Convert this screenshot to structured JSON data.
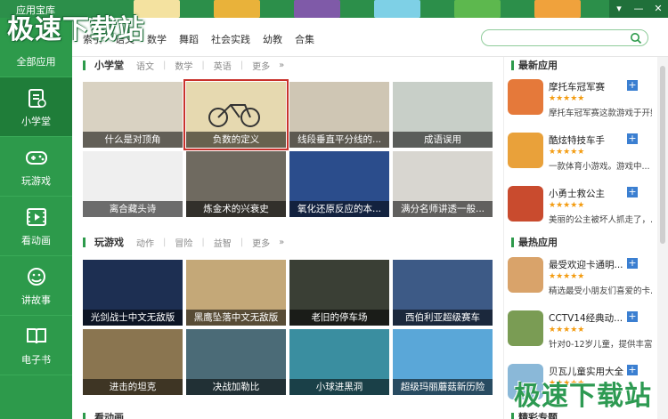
{
  "app": {
    "title": "应用宝库",
    "watermark": "极速下载站",
    "controls": [
      "▾",
      "—",
      "✕"
    ]
  },
  "colors": {
    "brand": "#2d9a4b",
    "sidebar_active": "#1f7d39",
    "highlight": "#c9322c",
    "add": "#3b7fd1",
    "stars": "#f39c12"
  },
  "sidebar": {
    "items": [
      {
        "label": "全部应用",
        "icon": "grid-icon",
        "active": false
      },
      {
        "label": "小学堂",
        "icon": "book-icon",
        "active": true
      },
      {
        "label": "玩游戏",
        "icon": "gamepad-icon",
        "active": false
      },
      {
        "label": "看动画",
        "icon": "film-icon",
        "active": false
      },
      {
        "label": "讲故事",
        "icon": "story-icon",
        "active": false
      },
      {
        "label": "电子书",
        "icon": "ebook-icon",
        "active": false
      }
    ]
  },
  "nav": {
    "links": [
      "索引",
      "语文",
      "数学",
      "舞蹈",
      "社会实践",
      "幼教",
      "合集"
    ],
    "search_placeholder": ""
  },
  "sections": [
    {
      "name": "小学堂",
      "tags": [
        "语文",
        "数学",
        "英语",
        "更多"
      ],
      "tiles": [
        {
          "caption": "什么是对顶角",
          "color": "#d9d2c2",
          "highlight": false
        },
        {
          "caption": "负数的定义",
          "color": "#e6d9b0",
          "highlight": true
        },
        {
          "caption": "线段垂直平分线的...",
          "color": "#cfc6b4",
          "highlight": false
        },
        {
          "caption": "成语误用",
          "color": "#c8cfc8",
          "highlight": false
        },
        {
          "caption": "离合藏头诗",
          "color": "#efefef",
          "highlight": false
        },
        {
          "caption": "炼金术的兴衰史",
          "color": "#6f6a60",
          "highlight": false
        },
        {
          "caption": "氧化还原反应的本...",
          "color": "#2b4d8c",
          "highlight": false
        },
        {
          "caption": "满分名师讲透一般...",
          "color": "#d8d6d0",
          "highlight": false
        }
      ]
    },
    {
      "name": "玩游戏",
      "tags": [
        "动作",
        "冒险",
        "益智",
        "更多"
      ],
      "tiles": [
        {
          "caption": "光剑战士中文无敌版",
          "color": "#1d2f52",
          "highlight": false
        },
        {
          "caption": "黑鹰坠落中文无敌版",
          "color": "#c4a878",
          "highlight": false
        },
        {
          "caption": "老旧的停车场",
          "color": "#3a3f35",
          "highlight": false
        },
        {
          "caption": "西伯利亚超级赛车",
          "color": "#3d5a86",
          "highlight": false
        },
        {
          "caption": "进击的坦克",
          "color": "#8a7550",
          "highlight": false
        },
        {
          "caption": "决战加勒比",
          "color": "#4b6b77",
          "highlight": false
        },
        {
          "caption": "小球进黑洞",
          "color": "#3a8ea0",
          "highlight": false
        },
        {
          "caption": "超级玛丽蘑菇新历险",
          "color": "#5aa7d8",
          "highlight": false
        }
      ]
    }
  ],
  "bottom_section_peek": "看动画",
  "right": {
    "newest": {
      "title": "最新应用",
      "items": [
        {
          "title": "摩托车冠军赛",
          "stars": "★★★★★",
          "desc": "摩托车冠军赛这款游戏于开始...",
          "color": "#e5793a"
        },
        {
          "title": "酷炫特技车手",
          "stars": "★★★★★",
          "desc": "一款体育小游戏。游戏中...",
          "color": "#e9a13a"
        },
        {
          "title": "小勇士救公主",
          "stars": "★★★★★",
          "desc": "美丽的公主被坏人抓走了，...",
          "color": "#c94b2e"
        }
      ]
    },
    "hottest": {
      "title": "最热应用",
      "items": [
        {
          "title": "最受欢迎卡通明...",
          "stars": "★★★★★",
          "desc": "精选最受小朋友们喜爱的卡...",
          "color": "#d9a36a"
        },
        {
          "title": "CCTV14经典动...",
          "stars": "★★★★★",
          "desc": "针对0-12岁儿童，提供丰富...",
          "color": "#7a9c54"
        },
        {
          "title": "贝瓦儿童实用大全",
          "stars": "★★★★★",
          "desc": "",
          "color": "#8ab8d8"
        }
      ]
    },
    "peek_title": "精彩专题"
  }
}
